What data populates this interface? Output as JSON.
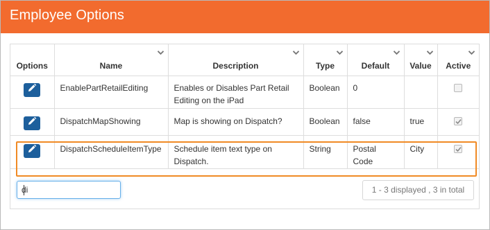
{
  "header": {
    "title": "Employee Options",
    "bg_color": "#f26b2e"
  },
  "table": {
    "columns": [
      {
        "label": "Options",
        "sortable": false
      },
      {
        "label": "Name",
        "sortable": true
      },
      {
        "label": "Description",
        "sortable": true
      },
      {
        "label": "Type",
        "sortable": true
      },
      {
        "label": "Default",
        "sortable": true
      },
      {
        "label": "Value",
        "sortable": true
      },
      {
        "label": "Active",
        "sortable": true
      }
    ],
    "rows": [
      {
        "name": "EnablePartRetailEditing",
        "description": "Enables or Disables Part Retail Editing on the iPad",
        "type": "Boolean",
        "default": "0",
        "value": "",
        "active": false,
        "icon": "pencil-icon"
      },
      {
        "name": "DispatchMapShowing",
        "description": "Map is showing on Dispatch?",
        "type": "Boolean",
        "default": "false",
        "value": "true",
        "active": true,
        "icon": "pencil-icon"
      },
      {
        "name": "DispatchScheduleItemType",
        "description": "Schedule item text type on Dispatch.",
        "type": "String",
        "default": "Postal Code",
        "value": "City",
        "active": true,
        "icon": "pencil-icon",
        "highlighted": true
      }
    ]
  },
  "search": {
    "value": "di",
    "placeholder": ""
  },
  "pager": {
    "info": "1 - 3 displayed , 3 in total"
  },
  "colors": {
    "edit_button": "#1d5f9c",
    "highlight_border": "#f08a24",
    "focus_border": "#66afe9"
  }
}
